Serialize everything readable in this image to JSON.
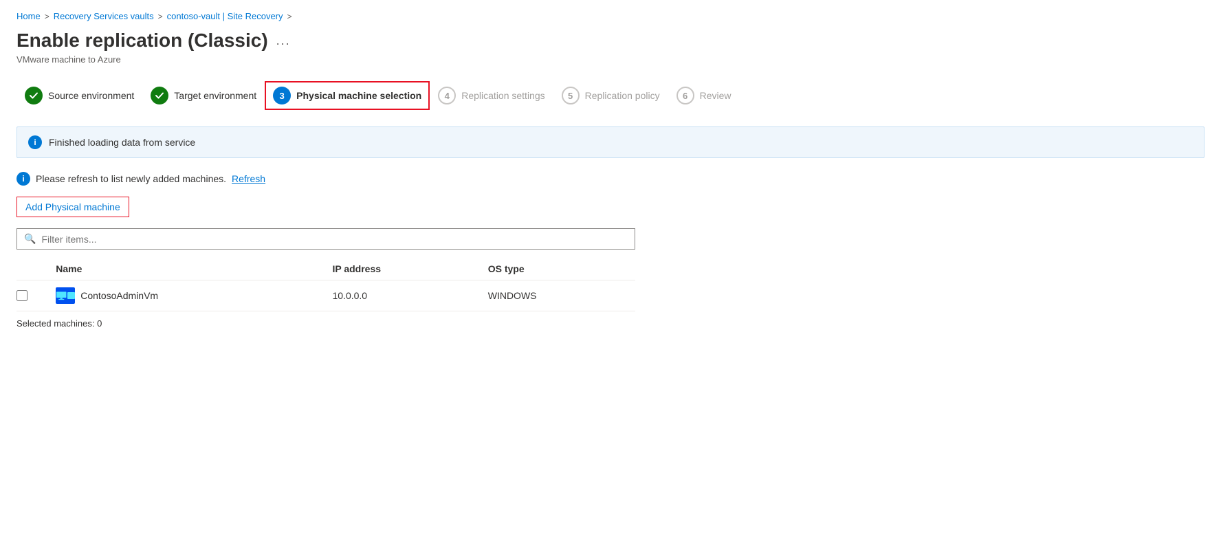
{
  "breadcrumb": {
    "items": [
      {
        "label": "Home",
        "href": "#"
      },
      {
        "label": "Recovery Services vaults",
        "href": "#"
      },
      {
        "label": "contoso-vault | Site Recovery",
        "href": "#"
      }
    ],
    "separator": ">"
  },
  "header": {
    "title": "Enable replication (Classic)",
    "more_icon": "...",
    "subtitle": "VMware machine to Azure"
  },
  "wizard": {
    "steps": [
      {
        "number": "✓",
        "label": "Source environment",
        "state": "completed"
      },
      {
        "number": "✓",
        "label": "Target environment",
        "state": "completed"
      },
      {
        "number": "3",
        "label": "Physical machine selection",
        "state": "active"
      },
      {
        "number": "4",
        "label": "Replication settings",
        "state": "inactive"
      },
      {
        "number": "5",
        "label": "Replication policy",
        "state": "inactive"
      },
      {
        "number": "6",
        "label": "Review",
        "state": "inactive"
      }
    ]
  },
  "info_banner": {
    "text": "Finished loading data from service"
  },
  "refresh_notice": {
    "text": "Please refresh to list newly added machines.",
    "link_text": "Refresh"
  },
  "add_button": {
    "label": "Add Physical machine"
  },
  "filter": {
    "placeholder": "Filter items..."
  },
  "table": {
    "columns": [
      "Name",
      "IP address",
      "OS type"
    ],
    "rows": [
      {
        "name": "ContosoAdminVm",
        "ip_address": "10.0.0.0",
        "os_type": "WINDOWS",
        "checked": false
      }
    ]
  },
  "selected_count": {
    "label": "Selected machines: 0"
  }
}
